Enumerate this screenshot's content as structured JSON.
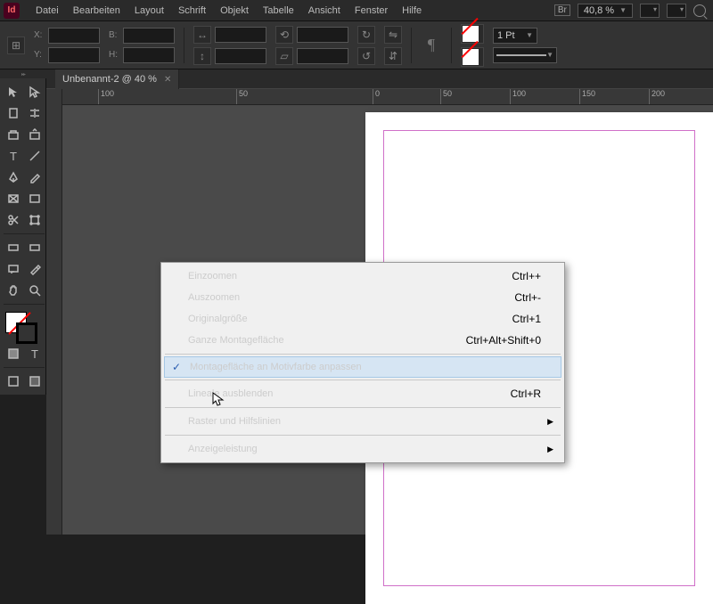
{
  "menubar": {
    "items": [
      "Datei",
      "Bearbeiten",
      "Layout",
      "Schrift",
      "Objekt",
      "Tabelle",
      "Ansicht",
      "Fenster",
      "Hilfe"
    ],
    "bridge": "Br",
    "zoom": "40,8 %"
  },
  "controlbar": {
    "x_label": "X:",
    "y_label": "Y:",
    "w_label": "B:",
    "h_label": "H:",
    "stroke_weight": "1 Pt"
  },
  "tab": {
    "title": "Unbenannt-2 @ 40 %"
  },
  "ruler": {
    "ticks": [
      "100",
      "50",
      "0",
      "50",
      "100",
      "150",
      "200"
    ]
  },
  "context_menu": {
    "items": [
      {
        "label": "Einzoomen",
        "shortcut": "Ctrl++"
      },
      {
        "label": "Auszoomen",
        "shortcut": "Ctrl+-"
      },
      {
        "label": "Originalgröße",
        "shortcut": "Ctrl+1"
      },
      {
        "label": "Ganze Montagefläche",
        "shortcut": "Ctrl+Alt+Shift+0"
      }
    ],
    "highlighted": {
      "label": "Montagefläche an Motivfarbe anpassen",
      "checked": true
    },
    "rulers": {
      "label": "Lineale ausblenden",
      "shortcut": "Ctrl+R"
    },
    "submenus": [
      {
        "label": "Raster und Hilfslinien"
      },
      {
        "label": "Anzeigeleistung"
      }
    ]
  }
}
